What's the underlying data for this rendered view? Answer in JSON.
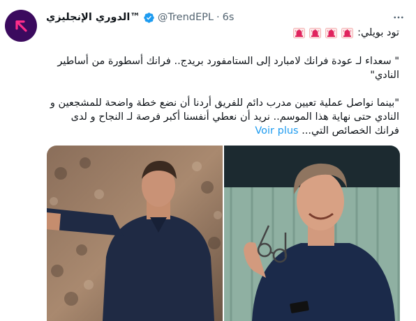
{
  "tweet": {
    "display_name": "الدوري الإنجليزي™",
    "handle": "@TrendEPL",
    "separator": "·",
    "time": "6s",
    "line1_text": "تود بويلي:",
    "siren_count": 4,
    "paragraph1": "\" سعداء لـ عودة فرانك لامبارد إلى الستامفورد بريدج.. فرانك أسطورة من أساطير النادي\"",
    "paragraph2": "\"بينما نواصل عملية تعيين مدرب دائم للفريق أردنا أن نضع خطة واضحة للمشجعين و النادي حتى نهاية هذا الموسم.. نريد أن نعطي أنفسنا أكبر فرصة لـ النجاح و لدى فرانك الخصائص التي...",
    "voir_plus": "Voir plus"
  },
  "icons": {
    "avatar": "arrow-logo-icon",
    "verified": "verified-badge-icon",
    "more": "more-options-icon",
    "siren": "police-light-icon"
  },
  "colors": {
    "link": "#1d9bf0",
    "verified": "#1d9bf0",
    "secondary_text": "#536471",
    "avatar_bg": "#3b0a5e",
    "avatar_arrow": "#ff2d8a"
  }
}
